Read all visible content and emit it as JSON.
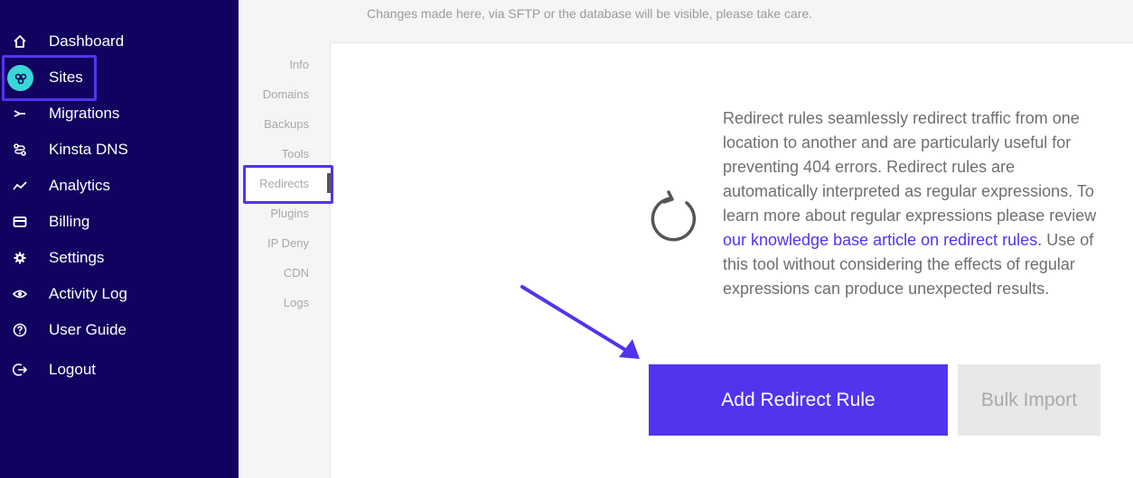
{
  "sidebar": {
    "items": [
      {
        "label": "Dashboard",
        "icon": "home-icon"
      },
      {
        "label": "Sites",
        "icon": "sites-icon"
      },
      {
        "label": "Migrations",
        "icon": "migrations-icon"
      },
      {
        "label": "Kinsta DNS",
        "icon": "dns-icon"
      },
      {
        "label": "Analytics",
        "icon": "analytics-icon"
      },
      {
        "label": "Billing",
        "icon": "billing-icon"
      },
      {
        "label": "Settings",
        "icon": "gear-icon"
      },
      {
        "label": "Activity Log",
        "icon": "eye-icon"
      },
      {
        "label": "User Guide",
        "icon": "help-icon"
      },
      {
        "label": "Logout",
        "icon": "logout-icon"
      }
    ],
    "active": "Sites"
  },
  "notice": "Changes made here, via SFTP or the database will be visible, please take care.",
  "subnav": {
    "items": [
      "Info",
      "Domains",
      "Backups",
      "Tools",
      "Redirects",
      "Plugins",
      "IP Deny",
      "CDN",
      "Logs"
    ],
    "active": "Redirects"
  },
  "main": {
    "description_before_link": "Redirect rules seamlessly redirect traffic from one location to another and are particularly useful for preventing 404 errors. Redirect rules are automatically interpreted as regular expressions. To learn more about regular expressions please review ",
    "link_text": "our knowledge base article on redirect rules.",
    "description_after_link": " Use of this tool without considering the effects of regular expressions can produce unexpected results.",
    "add_button": "Add Redirect Rule",
    "bulk_button": "Bulk Import"
  },
  "colors": {
    "sidebar_bg": "#10025e",
    "accent": "#5333ed",
    "sites_icon": "#3ad7d7"
  }
}
